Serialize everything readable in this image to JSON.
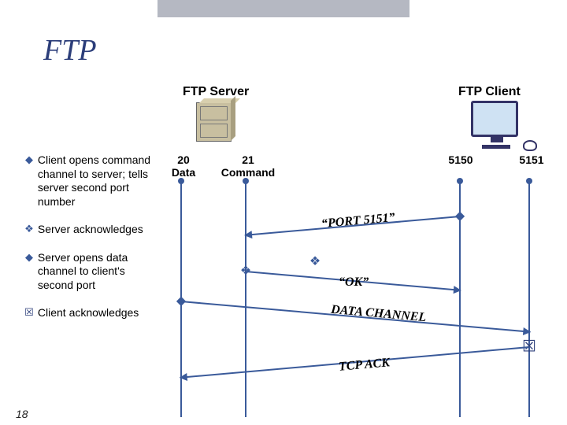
{
  "title": "FTP",
  "headers": {
    "server": "FTP Server",
    "client": "FTP Client"
  },
  "ports": {
    "p20_num": "20",
    "p20_name": "Data",
    "p21_num": "21",
    "p21_name": "Command",
    "p5150": "5150",
    "p5151": "5151"
  },
  "bullets": {
    "b1": "Client opens command channel to server; tells server second port number",
    "b2": "Server acknowledges",
    "b3": "Server opens data channel to client's second port",
    "b4": "Client acknowledges"
  },
  "icons": {
    "diamond": "◆",
    "diamond_open": "❖",
    "xbox": "☒"
  },
  "msgs": {
    "m1": "“PORT 5151”",
    "m2": "“OK”",
    "m3": "DATA CHANNEL",
    "m4": "TCP ACK"
  },
  "page": "18"
}
